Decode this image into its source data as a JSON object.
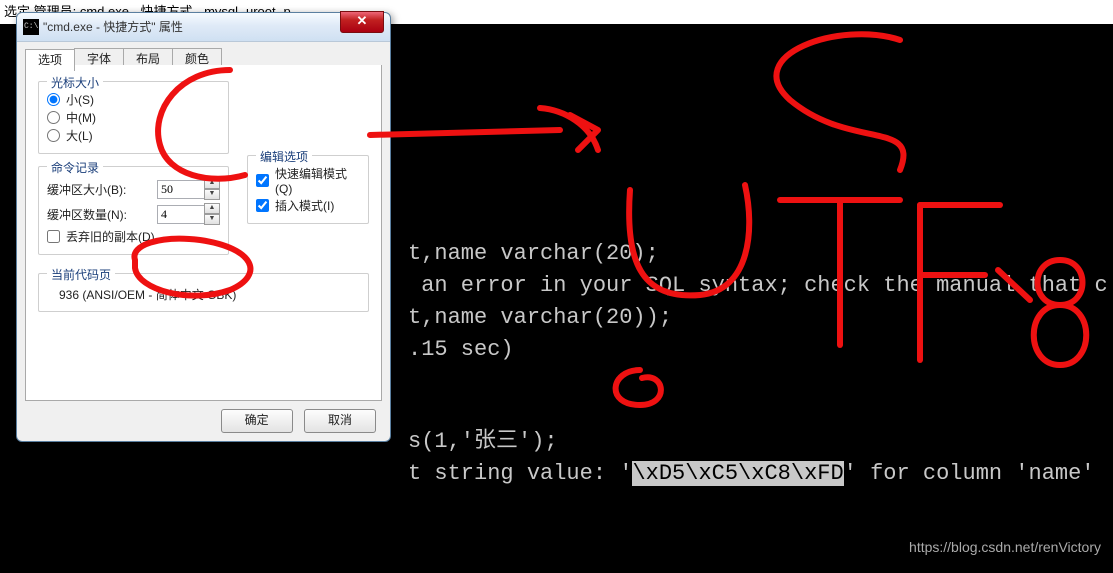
{
  "terminal": {
    "top_bar": "选定 管理员: cmd.exe - 快捷方式 - mysql -uroot -p",
    "line1_tail": "t,name varchar(20);",
    "line2_tail": " an error in your SQL syntax; check the manual that c",
    "line3_tail": "t,name varchar(20));",
    "line4_tail": ".15 sec)",
    "line5_tail": "s(1,'张三');",
    "line6_pre": "t string value: '",
    "line6_hl": "\\xD5\\xC5\\xC8\\xFD",
    "line6_post": "' for column 'name'",
    "watermark": "https://blog.csdn.net/renVictory"
  },
  "dialog": {
    "title": "\"cmd.exe - 快捷方式\" 属性",
    "close_glyph": "✕",
    "tabs": [
      "选项",
      "字体",
      "布局",
      "颜色"
    ],
    "cursor_group": {
      "legend": "光标大小",
      "small": "小(S)",
      "medium": "中(M)",
      "large": "大(L)"
    },
    "history_group": {
      "legend": "命令记录",
      "buffer_size_label": "缓冲区大小(B):",
      "buffer_size_value": "50",
      "buffer_count_label": "缓冲区数量(N):",
      "buffer_count_value": "4",
      "discard_label": "丢弃旧的副本(D)"
    },
    "edit_group": {
      "legend": "编辑选项",
      "quick_edit": "快速编辑模式(Q)",
      "insert_mode": "插入模式(I)"
    },
    "codepage_group": {
      "legend": "当前代码页",
      "value": "936   (ANSI/OEM - 简体中文 GBK)"
    },
    "ok": "确定",
    "cancel": "取消"
  },
  "annotation_text": "SUTF-8"
}
